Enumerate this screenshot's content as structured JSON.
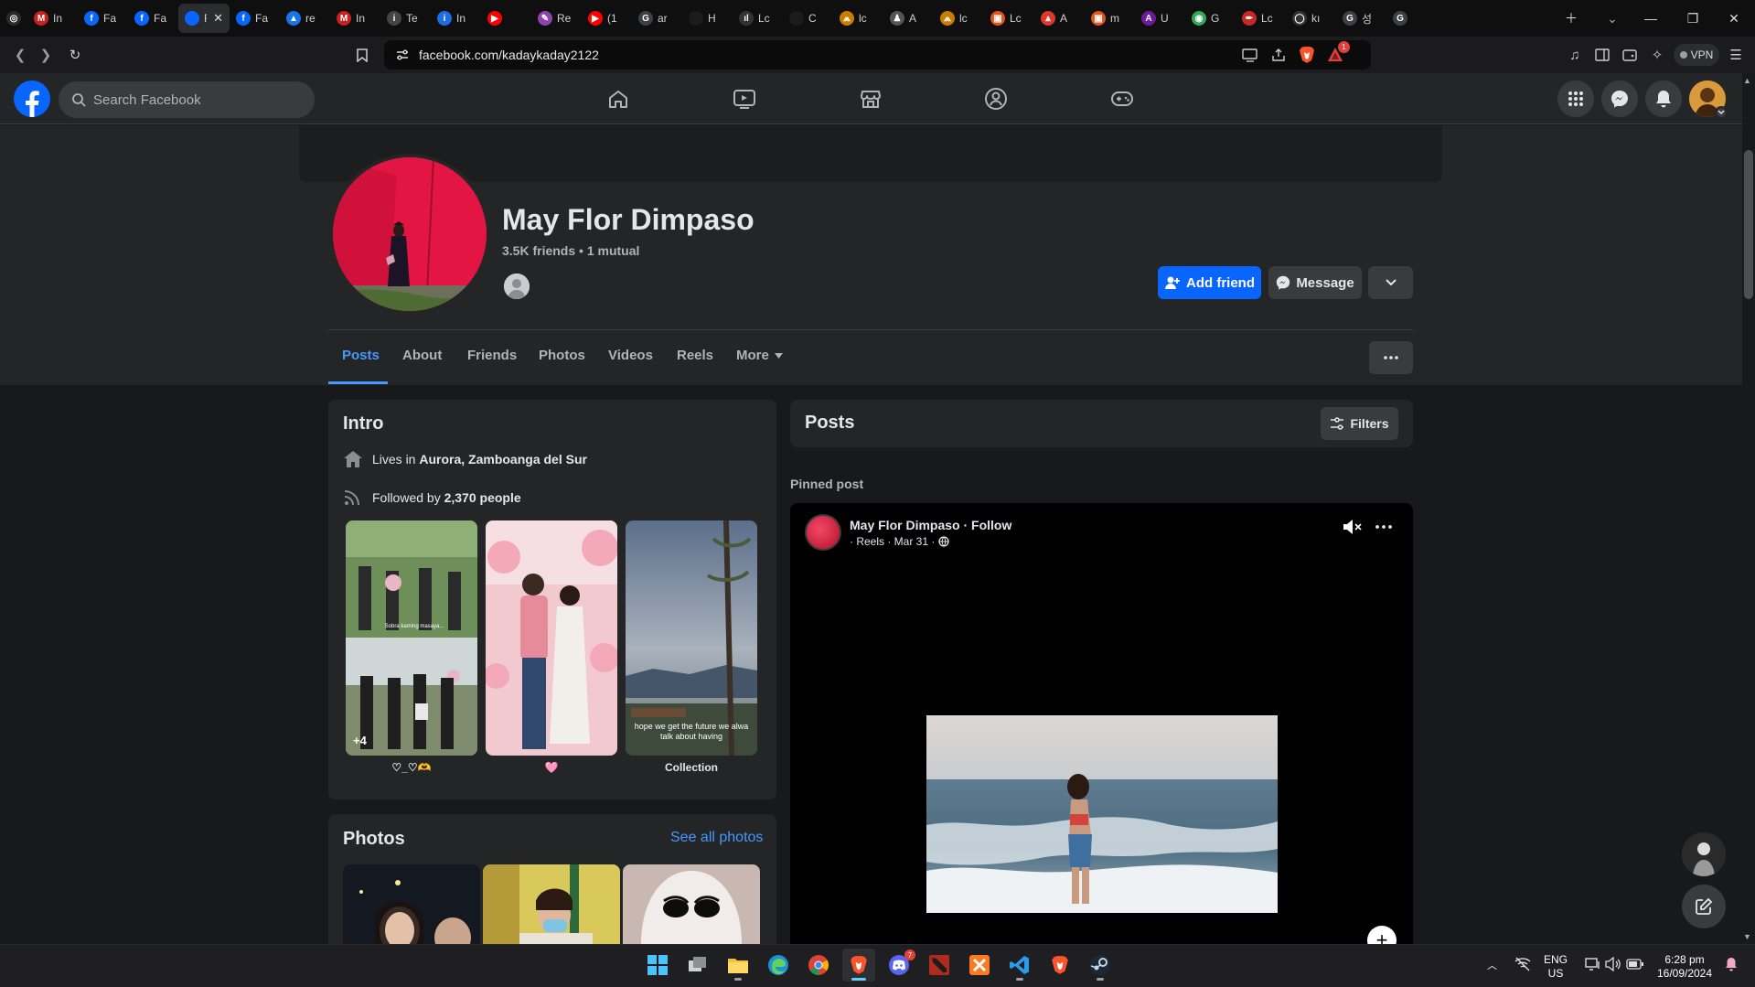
{
  "browser": {
    "tabs": [
      {
        "label": "",
        "fav": "◎",
        "color": "#2b2b2b"
      },
      {
        "label": "In",
        "fav": "M",
        "color": "#c5221f"
      },
      {
        "label": "Fa",
        "fav": "f",
        "color": "#0866ff"
      },
      {
        "label": "Fa",
        "fav": "f",
        "color": "#0866ff"
      },
      {
        "label": "Fa",
        "fav": "",
        "color": "#0866ff",
        "active": true
      },
      {
        "label": "Fa",
        "fav": "f",
        "color": "#0866ff"
      },
      {
        "label": "re",
        "fav": "▲",
        "color": "#1a73e8"
      },
      {
        "label": "In",
        "fav": "M",
        "color": "#c5221f"
      },
      {
        "label": "Te",
        "fav": "i",
        "color": "#444"
      },
      {
        "label": "In",
        "fav": "i",
        "color": "#1e6be6"
      },
      {
        "label": "",
        "fav": "▶",
        "color": "#ff0000"
      },
      {
        "label": "Re",
        "fav": "✎",
        "color": "#8e44ad"
      },
      {
        "label": "(1",
        "fav": "▶",
        "color": "#ff0000"
      },
      {
        "label": "ar",
        "fav": "G",
        "color": "#3c4043"
      },
      {
        "label": "H",
        "fav": "",
        "color": "#1b1b1b"
      },
      {
        "label": "Lc",
        "fav": "ıl",
        "color": "#333"
      },
      {
        "label": "C",
        "fav": "",
        "color": "#1b1b1b"
      },
      {
        "label": "lc",
        "fav": "⩕",
        "color": "#c77d00"
      },
      {
        "label": "A",
        "fav": "♟",
        "color": "#555"
      },
      {
        "label": "lc",
        "fav": "⩕",
        "color": "#c77d00"
      },
      {
        "label": "Lc",
        "fav": "▣",
        "color": "#e2541b"
      },
      {
        "label": "A",
        "fav": "⩓",
        "color": "#d93a2b"
      },
      {
        "label": "m",
        "fav": "▣",
        "color": "#e2541b"
      },
      {
        "label": "U",
        "fav": "A",
        "color": "#6a1b9a"
      },
      {
        "label": "G",
        "fav": "◉",
        "color": "#34a853"
      },
      {
        "label": "Lc",
        "fav": "✒",
        "color": "#c62828"
      },
      {
        "label": "kı",
        "fav": "◯",
        "color": "#333"
      },
      {
        "label": "성",
        "fav": "G",
        "color": "#3c4043"
      },
      {
        "label": "",
        "fav": "G",
        "color": "#3c4043"
      }
    ],
    "url": "facebook.com/kadaykaday2122",
    "vpn_label": "VPN",
    "brave_badge": "1"
  },
  "fb": {
    "search_placeholder": "Search Facebook",
    "profile": {
      "name": "May Flor Dimpaso",
      "friends_line": "3.5K friends • 1 mutual",
      "add_friend": "Add friend",
      "message": "Message"
    },
    "tabs": [
      "Posts",
      "About",
      "Friends",
      "Photos",
      "Videos",
      "Reels",
      "More"
    ],
    "intro": {
      "title": "Intro",
      "lives_prefix": "Lives in ",
      "lives_place": "Aurora, Zamboanga del Sur",
      "followed_prefix": "Followed by ",
      "followed_count": "2,370 people",
      "highlights": [
        {
          "caption": "♡_♡🫶",
          "overlay": "+4",
          "text": "Sobra kaming masaya..."
        },
        {
          "caption": "🩷",
          "overlay": "",
          "text": ""
        },
        {
          "caption": "Collection",
          "overlay": "",
          "text": "hope we get the future we alwa\ntalk about having"
        }
      ]
    },
    "photos": {
      "title": "Photos",
      "see_all": "See all photos"
    },
    "posts": {
      "title": "Posts",
      "filters": "Filters",
      "pinned_label": "Pinned post",
      "author": "May Flor Dimpaso · Follow",
      "meta": "· Reels · Mar 31 ·"
    }
  },
  "taskbar": {
    "lang1": "ENG",
    "lang2": "US",
    "time": "6:28 pm",
    "date": "16/09/2024",
    "discord_badge": "7"
  }
}
